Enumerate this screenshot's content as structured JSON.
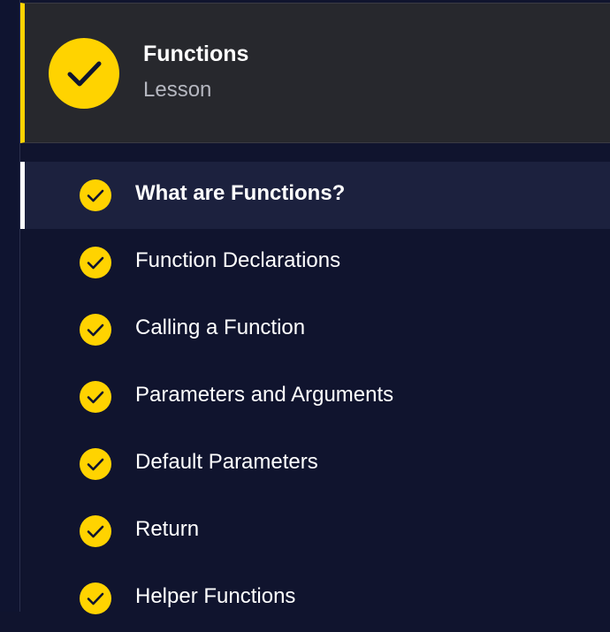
{
  "lesson": {
    "title": "Functions",
    "subtitle": "Lesson",
    "status_icon": "check-circle-icon"
  },
  "items": [
    {
      "label": "What are Functions?",
      "active": true,
      "icon": "check-circle-icon"
    },
    {
      "label": "Function Declarations",
      "active": false,
      "icon": "check-circle-icon"
    },
    {
      "label": "Calling a Function",
      "active": false,
      "icon": "check-circle-icon"
    },
    {
      "label": "Parameters and Arguments",
      "active": false,
      "icon": "check-circle-icon"
    },
    {
      "label": "Default Parameters",
      "active": false,
      "icon": "check-circle-icon"
    },
    {
      "label": "Return",
      "active": false,
      "icon": "check-circle-icon"
    },
    {
      "label": "Helper Functions",
      "active": false,
      "icon": "check-circle-icon"
    }
  ],
  "colors": {
    "accent": "#ffd300",
    "background": "#10142e",
    "header_bg": "#27282d",
    "active_bg": "#1c213e"
  }
}
